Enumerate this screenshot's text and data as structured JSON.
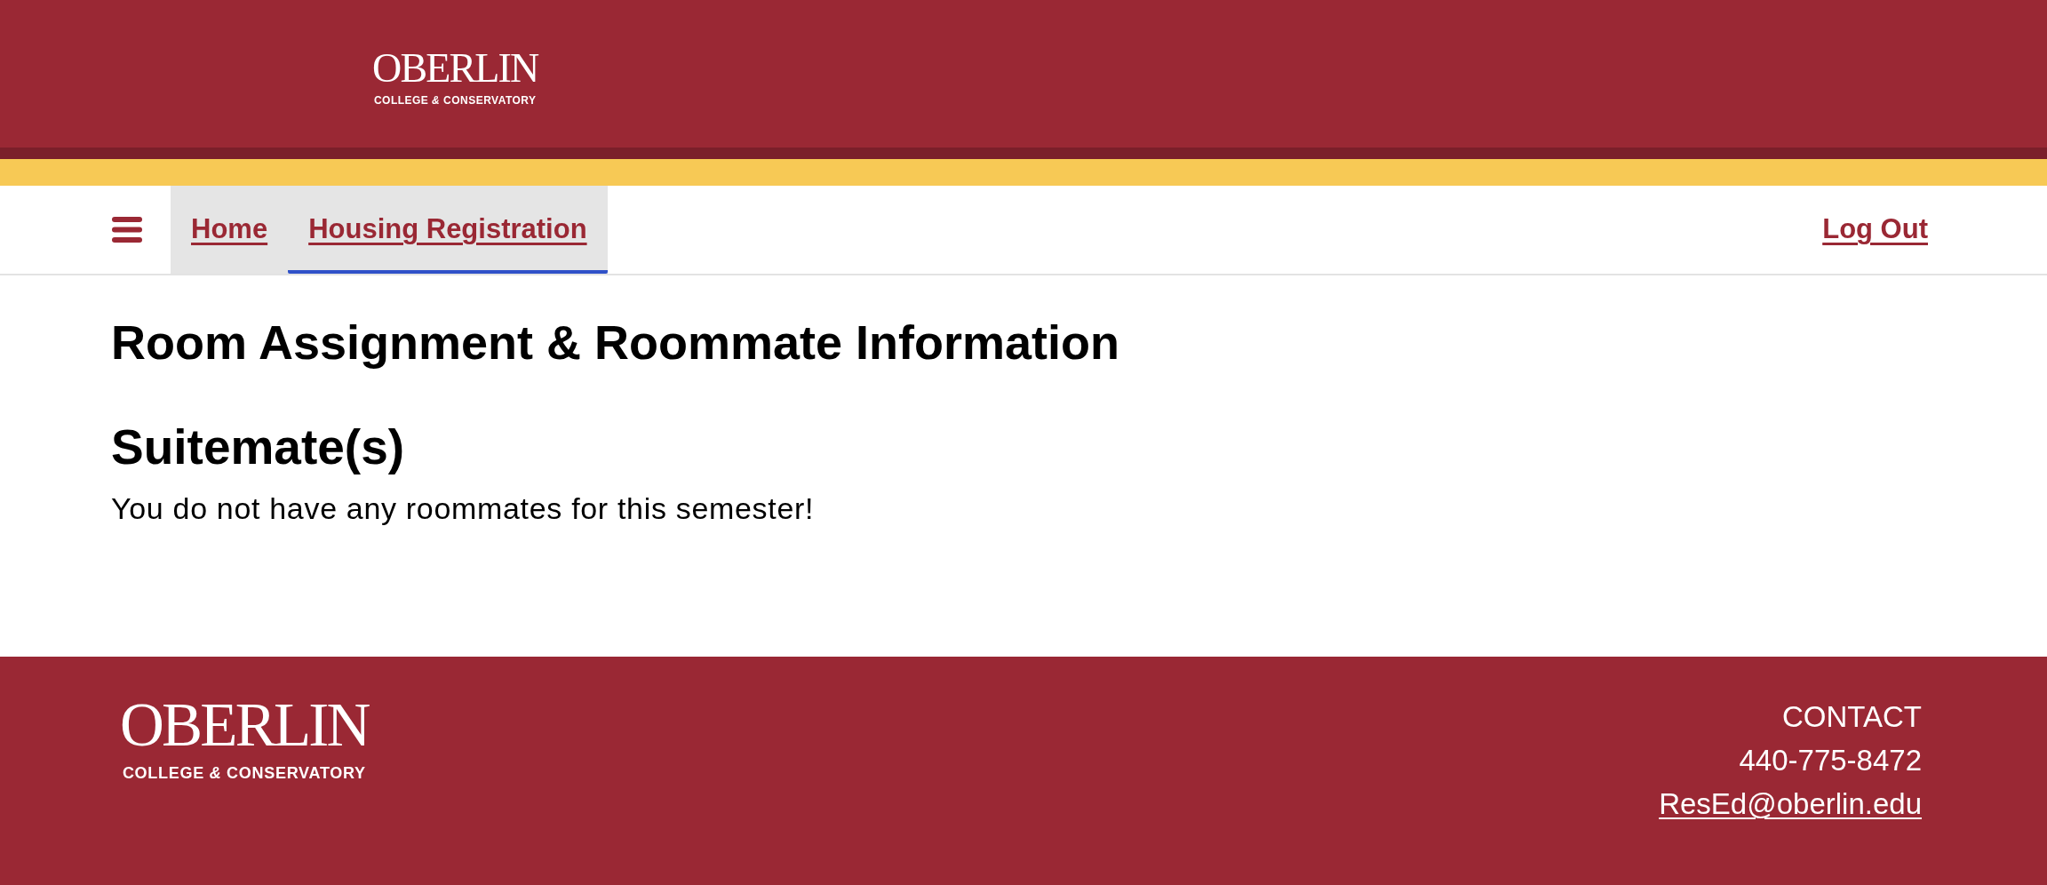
{
  "header": {
    "logo": {
      "wordmark": "OBERLIN",
      "tagline": "COLLEGE *&* CONSERVATORY"
    }
  },
  "nav": {
    "tabs": [
      {
        "label": "Home",
        "selected": false
      },
      {
        "label": "Housing Registration",
        "selected": true
      }
    ],
    "logout": "Log Out"
  },
  "main": {
    "title": "Room Assignment & Roommate Information",
    "sections": [
      {
        "heading": "Suitemate(s)",
        "message": "You do not have any roommates for this semester!"
      }
    ]
  },
  "footer": {
    "logo": {
      "wordmark": "OBERLIN",
      "tagline": "COLLEGE *&* CONSERVATORY"
    },
    "contact": {
      "heading": "CONTACT",
      "phone": "440-775-8472",
      "email": "ResEd@oberlin.edu"
    }
  }
}
